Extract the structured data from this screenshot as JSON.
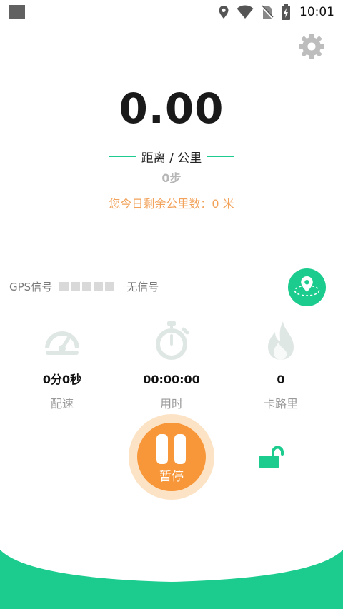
{
  "status_bar": {
    "time": "10:01"
  },
  "run": {
    "distance": "0.00",
    "distance_unit": "距离 / 公里",
    "steps": "0步",
    "remaining": "您今日剩余公里数：0 米"
  },
  "gps": {
    "label": "GPS信号",
    "status": "无信号",
    "signal_level": 0
  },
  "stats": [
    {
      "value": "0分0秒",
      "label": "配速",
      "icon": "speedometer-icon"
    },
    {
      "value": "00:00:00",
      "label": "用时",
      "icon": "stopwatch-icon"
    },
    {
      "value": "0",
      "label": "卡路里",
      "icon": "flame-icon"
    }
  ],
  "controls": {
    "pause_label": "暂停"
  },
  "colors": {
    "accent": "#1bcc8e",
    "orange": "#f7973a",
    "orange_light": "#fde3c6",
    "remain_text": "#f2a25a"
  }
}
